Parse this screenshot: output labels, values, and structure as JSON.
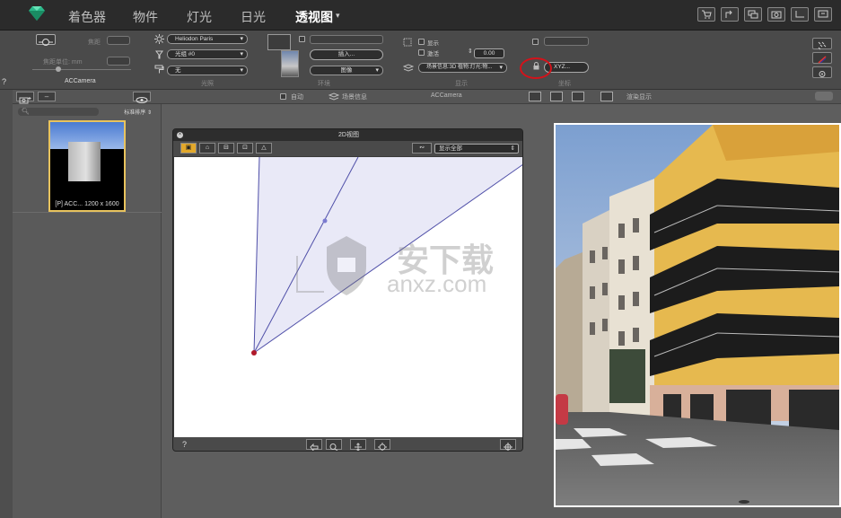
{
  "menubar": {
    "items": [
      {
        "label": "着色器"
      },
      {
        "label": "物件"
      },
      {
        "label": "灯光"
      },
      {
        "label": "日光"
      },
      {
        "label": "透视图",
        "active": true
      }
    ],
    "right_icons": [
      "cart-icon",
      "share-icon",
      "windows-icon",
      "camera-icon",
      "monitor-icon",
      "screen-icon"
    ]
  },
  "toolbar": {
    "camera_label": "ACCamera",
    "lighting_group_label": "光照",
    "environment_group_label": "环境",
    "display_group_label": "显示",
    "coords_group_label": "坐标",
    "heliodon_dropdown": "Heliodon Paris",
    "lightgroup_dropdown": "光组 #0",
    "none_dropdown": "无",
    "import_button": "插入...",
    "image_dropdown": "图像",
    "display_checkbox": "显示",
    "activate_checkbox": "激活",
    "value_field": "0.00",
    "sceneinfo_dropdown": "场景信息:3D 植物:灯光:物...",
    "xyz_field": "XYZ...",
    "focal_label": "焦距",
    "sensor_label": "焦距单位: mm"
  },
  "subbar": {
    "auto_label": "自动",
    "sceneinfo_label": "场景信息",
    "camera_label": "ACCamera",
    "render_label": "渲染显示"
  },
  "leftpanel": {
    "search_placeholder": "",
    "sort_label": "标准排序 ⇕",
    "thumb_label": "[P] ACC... 1200 x 1600",
    "help_symbol": "?"
  },
  "window2d": {
    "title": "2D视图",
    "show_all_dropdown": "显示全部",
    "help_symbol": "?"
  },
  "watermark": {
    "text_cn": "安下载",
    "text_en": "anxz.com"
  },
  "colors": {
    "accent_gold": "#e2a82b",
    "highlight_red": "#d4121a",
    "camera_point": "#b0192a",
    "view_fill": "#e8e8f7",
    "view_line": "#4f4fa8"
  }
}
